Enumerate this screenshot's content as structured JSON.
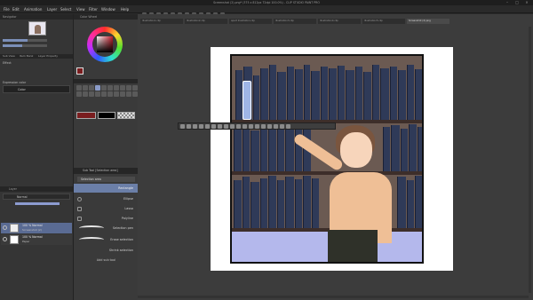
{
  "window": {
    "title": "Screenshot (2).png* (375 x 812px 72dpi 100.0%) - CLIP STUDIO PAINT PRO",
    "controls": [
      "–",
      "□",
      "×"
    ]
  },
  "menu": [
    "File",
    "Edit",
    "Animation",
    "Layer",
    "Select",
    "View",
    "Filter",
    "Window",
    "Help"
  ],
  "navigator": {
    "title": "Navigator"
  },
  "sub_view_tabs": [
    "Sub View",
    "Item Bank",
    "Layer Property"
  ],
  "layer_property": {
    "effect_label": "Effect",
    "expression_label": "Expression color",
    "expression_value": "Color"
  },
  "color_panel": {
    "title": "Color Wheel",
    "foreground": "#7a1d1f"
  },
  "tool_panel": {
    "title": "Tool"
  },
  "swatches": {
    "main": "#7a1d1f",
    "second": "#000000"
  },
  "sub_tool": {
    "header": "Sub Tool [Selection area]",
    "group": "Selection area",
    "selected": "Rectangle",
    "items": [
      "Ellipse",
      "Lasso",
      "Polyline",
      "Selection pen",
      "Erase selection",
      "Shrink selection"
    ],
    "add_label": "Add sub tool"
  },
  "layer_panel": {
    "title": "Layer",
    "blend_mode": "Normal",
    "opacity": 100,
    "layers": [
      {
        "name": "100 % Normal",
        "sub": "Screenshot (2)"
      },
      {
        "name": "100 % Normal",
        "sub": "Paper"
      }
    ]
  },
  "doc_tabs": [
    "Illustration1.clip",
    "Illustration2.clip",
    "apart illustration.clip",
    "Illustration3.clip",
    "Illustration4.clip",
    "Illustration5.clip",
    "Screenshot (2).png"
  ],
  "colors": {
    "accent": "#6b7fa8",
    "panel": "#353535",
    "canvas_bg": "#3c3c3c"
  }
}
